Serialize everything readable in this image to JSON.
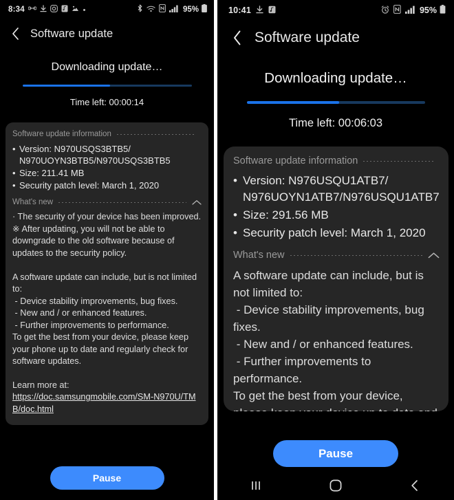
{
  "left": {
    "statusbar": {
      "time": "8:34",
      "left_icons": [
        "headphones-icon",
        "download-icon",
        "instagram-icon",
        "music-note-icon",
        "photo-icon",
        "dot-icon"
      ],
      "right_icons": [
        "bluetooth-icon",
        "wifi-icon",
        "nfc-icon",
        "signal-icon"
      ],
      "battery_percent": "95%"
    },
    "title": "Software update",
    "back_icon": "back-chevron-icon",
    "progress": {
      "heading": "Downloading update…",
      "percent": 52,
      "time_left": "Time left: 00:00:14"
    },
    "info_section_label": "Software update information",
    "specs": [
      {
        "bullet": "•",
        "text": "Version: N970USQS3BTB5/\nN970UOYN3BTB5/N970USQS3BTB5"
      },
      {
        "bullet": "•",
        "text": "Size: 211.41 MB"
      },
      {
        "bullet": "•",
        "text": "Security patch level: March 1, 2020"
      }
    ],
    "whats_new_label": "What's new",
    "whats_new_caret": "chevron-up-icon",
    "whats_new_body": "· The security of your device has been improved.\n※ After updating, you will not be able to downgrade to the old software because of updates to the security policy.\n\nA software update can include, but is not limited to:\n - Device stability improvements, bug fixes.\n - New and / or enhanced features.\n - Further improvements to performance.\nTo get the best from your device, please keep your phone up to date and regularly check for software updates.",
    "learn_more_label": "Learn more at:",
    "learn_more_url": "https://doc.samsungmobile.com/SM-N970U/TMB/doc.html",
    "pause_label": "Pause"
  },
  "right": {
    "statusbar": {
      "time": "10:41",
      "left_icons": [
        "download-icon",
        "music-note-icon"
      ],
      "right_icons": [
        "alarm-icon",
        "nfc-icon",
        "signal-icon"
      ],
      "battery_percent": "95%"
    },
    "title": "Software update",
    "back_icon": "back-chevron-icon",
    "progress": {
      "heading": "Downloading update…",
      "percent": 52,
      "time_left": "Time left: 00:06:03"
    },
    "info_section_label": "Software update information",
    "specs": [
      {
        "bullet": "•",
        "text": "Version: N976USQU1ATB7/\nN976UOYN1ATB7/N976USQU1ATB7"
      },
      {
        "bullet": "•",
        "text": "Size: 291.56 MB"
      },
      {
        "bullet": "•",
        "text": "Security patch level: March 1, 2020"
      }
    ],
    "whats_new_label": "What's new",
    "whats_new_caret": "chevron-up-icon",
    "whats_new_body": "A software update can include, but is not limited to:\n - Device stability improvements, bug fixes.\n - New and / or enhanced features.\n - Further improvements to performance.\nTo get the best from your device, please keep your device up to date and regularly check for software updates.",
    "pause_label": "Pause",
    "navbar": {
      "recents": "recents-icon",
      "home": "home-icon",
      "back": "back-icon"
    }
  },
  "colors": {
    "accent": "#1a72e8",
    "button": "#3d8bfd",
    "card": "#262626",
    "background": "#000000",
    "muted_text": "#9a9a9a"
  }
}
